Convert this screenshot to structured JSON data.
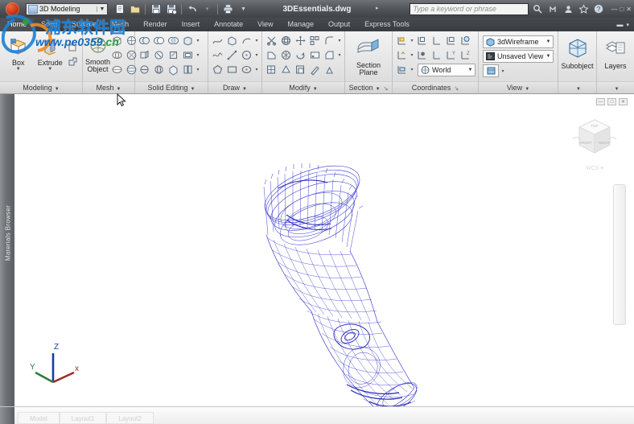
{
  "titlebar": {
    "workspace": "3D Modeling",
    "document_title": "3DEssentials.dwg",
    "search_placeholder": "Type a keyword or phrase",
    "qat": [
      {
        "name": "new-button",
        "label": "New"
      },
      {
        "name": "open-button",
        "label": "Open"
      },
      {
        "name": "save-button",
        "label": "Save"
      },
      {
        "name": "saveas-button",
        "label": "Save As"
      },
      {
        "name": "undo-button",
        "label": "Undo"
      },
      {
        "name": "redo-button",
        "label": "Redo"
      },
      {
        "name": "plot-button",
        "label": "Plot"
      }
    ],
    "infocenter": [
      {
        "name": "search-icon",
        "label": "Search"
      },
      {
        "name": "exchange-apps-icon",
        "label": "Autodesk Exchange Apps"
      },
      {
        "name": "signin-icon",
        "label": "Sign In"
      },
      {
        "name": "favorites-icon",
        "label": "Favorites"
      },
      {
        "name": "help-icon",
        "label": "Help"
      }
    ],
    "window_controls": [
      "—",
      "□",
      "✕"
    ]
  },
  "ribbon": {
    "tabs": [
      {
        "label": "Home",
        "active": true
      },
      {
        "label": "Solid",
        "active": false
      },
      {
        "label": "Surface",
        "active": false
      },
      {
        "label": "Mesh",
        "active": false
      },
      {
        "label": "Render",
        "active": false
      },
      {
        "label": "Insert",
        "active": false
      },
      {
        "label": "Annotate",
        "active": false
      },
      {
        "label": "View",
        "active": false
      },
      {
        "label": "Manage",
        "active": false
      },
      {
        "label": "Output",
        "active": false
      },
      {
        "label": "Express Tools",
        "active": false
      }
    ],
    "panels": {
      "modeling": {
        "label": "Modeling",
        "box_label": "Box",
        "extrude_label": "Extrude"
      },
      "mesh": {
        "label": "Mesh",
        "smooth_object_line1": "Smooth",
        "smooth_object_line2": "Object"
      },
      "solid_editing": {
        "label": "Solid Editing"
      },
      "draw": {
        "label": "Draw"
      },
      "modify": {
        "label": "Modify"
      },
      "section": {
        "label": "Section",
        "section_plane_line1": "Section",
        "section_plane_line2": "Plane"
      },
      "coordinates": {
        "label": "Coordinates",
        "ucs_value": "World"
      },
      "view": {
        "label": "View",
        "visual_style_value": "3dWireframe",
        "named_view_value": "Unsaved View"
      },
      "selection": {
        "label": "Subobject"
      },
      "layers": {
        "label": "Layers"
      }
    }
  },
  "left_rail": {
    "label": "Materials Browser"
  },
  "viewport": {
    "visual_style": "3dWireframe",
    "model_name": "flashlight-wireframe",
    "background_color": "#ffffff",
    "wireframe_color": "#2323c8",
    "ucs": {
      "x_label": "x",
      "y_label": "Y",
      "z_label": "Z",
      "x_color": "#9e2b2b",
      "y_color": "#2e7d32",
      "z_color": "#1a3fa0"
    },
    "viewcube_labels": {
      "top": "TOP",
      "front": "FRONT",
      "right": "RIGHT"
    },
    "controls": [
      "—",
      "□",
      "✕"
    ]
  },
  "bottombar": {
    "tabs": [
      "Model",
      "Layout1",
      "Layout2"
    ]
  },
  "watermark": {
    "text_cn": "浦东软件园",
    "url_www": "www.",
    "url_pe": "pe0359",
    "url_cn": ".cn"
  }
}
